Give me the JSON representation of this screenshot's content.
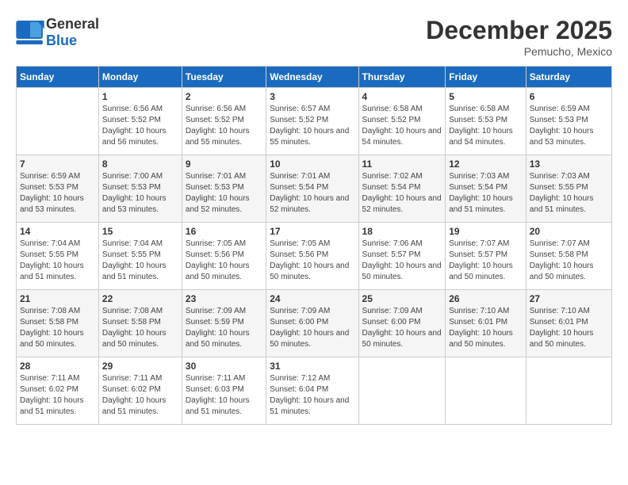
{
  "header": {
    "logo_general": "General",
    "logo_blue": "Blue",
    "month_year": "December 2025",
    "location": "Pemucho, Mexico"
  },
  "calendar": {
    "days_of_week": [
      "Sunday",
      "Monday",
      "Tuesday",
      "Wednesday",
      "Thursday",
      "Friday",
      "Saturday"
    ],
    "weeks": [
      [
        {
          "day": "",
          "sunrise": "",
          "sunset": "",
          "daylight": ""
        },
        {
          "day": "1",
          "sunrise": "Sunrise: 6:56 AM",
          "sunset": "Sunset: 5:52 PM",
          "daylight": "Daylight: 10 hours and 56 minutes."
        },
        {
          "day": "2",
          "sunrise": "Sunrise: 6:56 AM",
          "sunset": "Sunset: 5:52 PM",
          "daylight": "Daylight: 10 hours and 55 minutes."
        },
        {
          "day": "3",
          "sunrise": "Sunrise: 6:57 AM",
          "sunset": "Sunset: 5:52 PM",
          "daylight": "Daylight: 10 hours and 55 minutes."
        },
        {
          "day": "4",
          "sunrise": "Sunrise: 6:58 AM",
          "sunset": "Sunset: 5:52 PM",
          "daylight": "Daylight: 10 hours and 54 minutes."
        },
        {
          "day": "5",
          "sunrise": "Sunrise: 6:58 AM",
          "sunset": "Sunset: 5:53 PM",
          "daylight": "Daylight: 10 hours and 54 minutes."
        },
        {
          "day": "6",
          "sunrise": "Sunrise: 6:59 AM",
          "sunset": "Sunset: 5:53 PM",
          "daylight": "Daylight: 10 hours and 53 minutes."
        }
      ],
      [
        {
          "day": "7",
          "sunrise": "Sunrise: 6:59 AM",
          "sunset": "Sunset: 5:53 PM",
          "daylight": "Daylight: 10 hours and 53 minutes."
        },
        {
          "day": "8",
          "sunrise": "Sunrise: 7:00 AM",
          "sunset": "Sunset: 5:53 PM",
          "daylight": "Daylight: 10 hours and 53 minutes."
        },
        {
          "day": "9",
          "sunrise": "Sunrise: 7:01 AM",
          "sunset": "Sunset: 5:53 PM",
          "daylight": "Daylight: 10 hours and 52 minutes."
        },
        {
          "day": "10",
          "sunrise": "Sunrise: 7:01 AM",
          "sunset": "Sunset: 5:54 PM",
          "daylight": "Daylight: 10 hours and 52 minutes."
        },
        {
          "day": "11",
          "sunrise": "Sunrise: 7:02 AM",
          "sunset": "Sunset: 5:54 PM",
          "daylight": "Daylight: 10 hours and 52 minutes."
        },
        {
          "day": "12",
          "sunrise": "Sunrise: 7:03 AM",
          "sunset": "Sunset: 5:54 PM",
          "daylight": "Daylight: 10 hours and 51 minutes."
        },
        {
          "day": "13",
          "sunrise": "Sunrise: 7:03 AM",
          "sunset": "Sunset: 5:55 PM",
          "daylight": "Daylight: 10 hours and 51 minutes."
        }
      ],
      [
        {
          "day": "14",
          "sunrise": "Sunrise: 7:04 AM",
          "sunset": "Sunset: 5:55 PM",
          "daylight": "Daylight: 10 hours and 51 minutes."
        },
        {
          "day": "15",
          "sunrise": "Sunrise: 7:04 AM",
          "sunset": "Sunset: 5:55 PM",
          "daylight": "Daylight: 10 hours and 51 minutes."
        },
        {
          "day": "16",
          "sunrise": "Sunrise: 7:05 AM",
          "sunset": "Sunset: 5:56 PM",
          "daylight": "Daylight: 10 hours and 50 minutes."
        },
        {
          "day": "17",
          "sunrise": "Sunrise: 7:05 AM",
          "sunset": "Sunset: 5:56 PM",
          "daylight": "Daylight: 10 hours and 50 minutes."
        },
        {
          "day": "18",
          "sunrise": "Sunrise: 7:06 AM",
          "sunset": "Sunset: 5:57 PM",
          "daylight": "Daylight: 10 hours and 50 minutes."
        },
        {
          "day": "19",
          "sunrise": "Sunrise: 7:07 AM",
          "sunset": "Sunset: 5:57 PM",
          "daylight": "Daylight: 10 hours and 50 minutes."
        },
        {
          "day": "20",
          "sunrise": "Sunrise: 7:07 AM",
          "sunset": "Sunset: 5:58 PM",
          "daylight": "Daylight: 10 hours and 50 minutes."
        }
      ],
      [
        {
          "day": "21",
          "sunrise": "Sunrise: 7:08 AM",
          "sunset": "Sunset: 5:58 PM",
          "daylight": "Daylight: 10 hours and 50 minutes."
        },
        {
          "day": "22",
          "sunrise": "Sunrise: 7:08 AM",
          "sunset": "Sunset: 5:58 PM",
          "daylight": "Daylight: 10 hours and 50 minutes."
        },
        {
          "day": "23",
          "sunrise": "Sunrise: 7:09 AM",
          "sunset": "Sunset: 5:59 PM",
          "daylight": "Daylight: 10 hours and 50 minutes."
        },
        {
          "day": "24",
          "sunrise": "Sunrise: 7:09 AM",
          "sunset": "Sunset: 6:00 PM",
          "daylight": "Daylight: 10 hours and 50 minutes."
        },
        {
          "day": "25",
          "sunrise": "Sunrise: 7:09 AM",
          "sunset": "Sunset: 6:00 PM",
          "daylight": "Daylight: 10 hours and 50 minutes."
        },
        {
          "day": "26",
          "sunrise": "Sunrise: 7:10 AM",
          "sunset": "Sunset: 6:01 PM",
          "daylight": "Daylight: 10 hours and 50 minutes."
        },
        {
          "day": "27",
          "sunrise": "Sunrise: 7:10 AM",
          "sunset": "Sunset: 6:01 PM",
          "daylight": "Daylight: 10 hours and 50 minutes."
        }
      ],
      [
        {
          "day": "28",
          "sunrise": "Sunrise: 7:11 AM",
          "sunset": "Sunset: 6:02 PM",
          "daylight": "Daylight: 10 hours and 51 minutes."
        },
        {
          "day": "29",
          "sunrise": "Sunrise: 7:11 AM",
          "sunset": "Sunset: 6:02 PM",
          "daylight": "Daylight: 10 hours and 51 minutes."
        },
        {
          "day": "30",
          "sunrise": "Sunrise: 7:11 AM",
          "sunset": "Sunset: 6:03 PM",
          "daylight": "Daylight: 10 hours and 51 minutes."
        },
        {
          "day": "31",
          "sunrise": "Sunrise: 7:12 AM",
          "sunset": "Sunset: 6:04 PM",
          "daylight": "Daylight: 10 hours and 51 minutes."
        },
        {
          "day": "",
          "sunrise": "",
          "sunset": "",
          "daylight": ""
        },
        {
          "day": "",
          "sunrise": "",
          "sunset": "",
          "daylight": ""
        },
        {
          "day": "",
          "sunrise": "",
          "sunset": "",
          "daylight": ""
        }
      ]
    ]
  }
}
